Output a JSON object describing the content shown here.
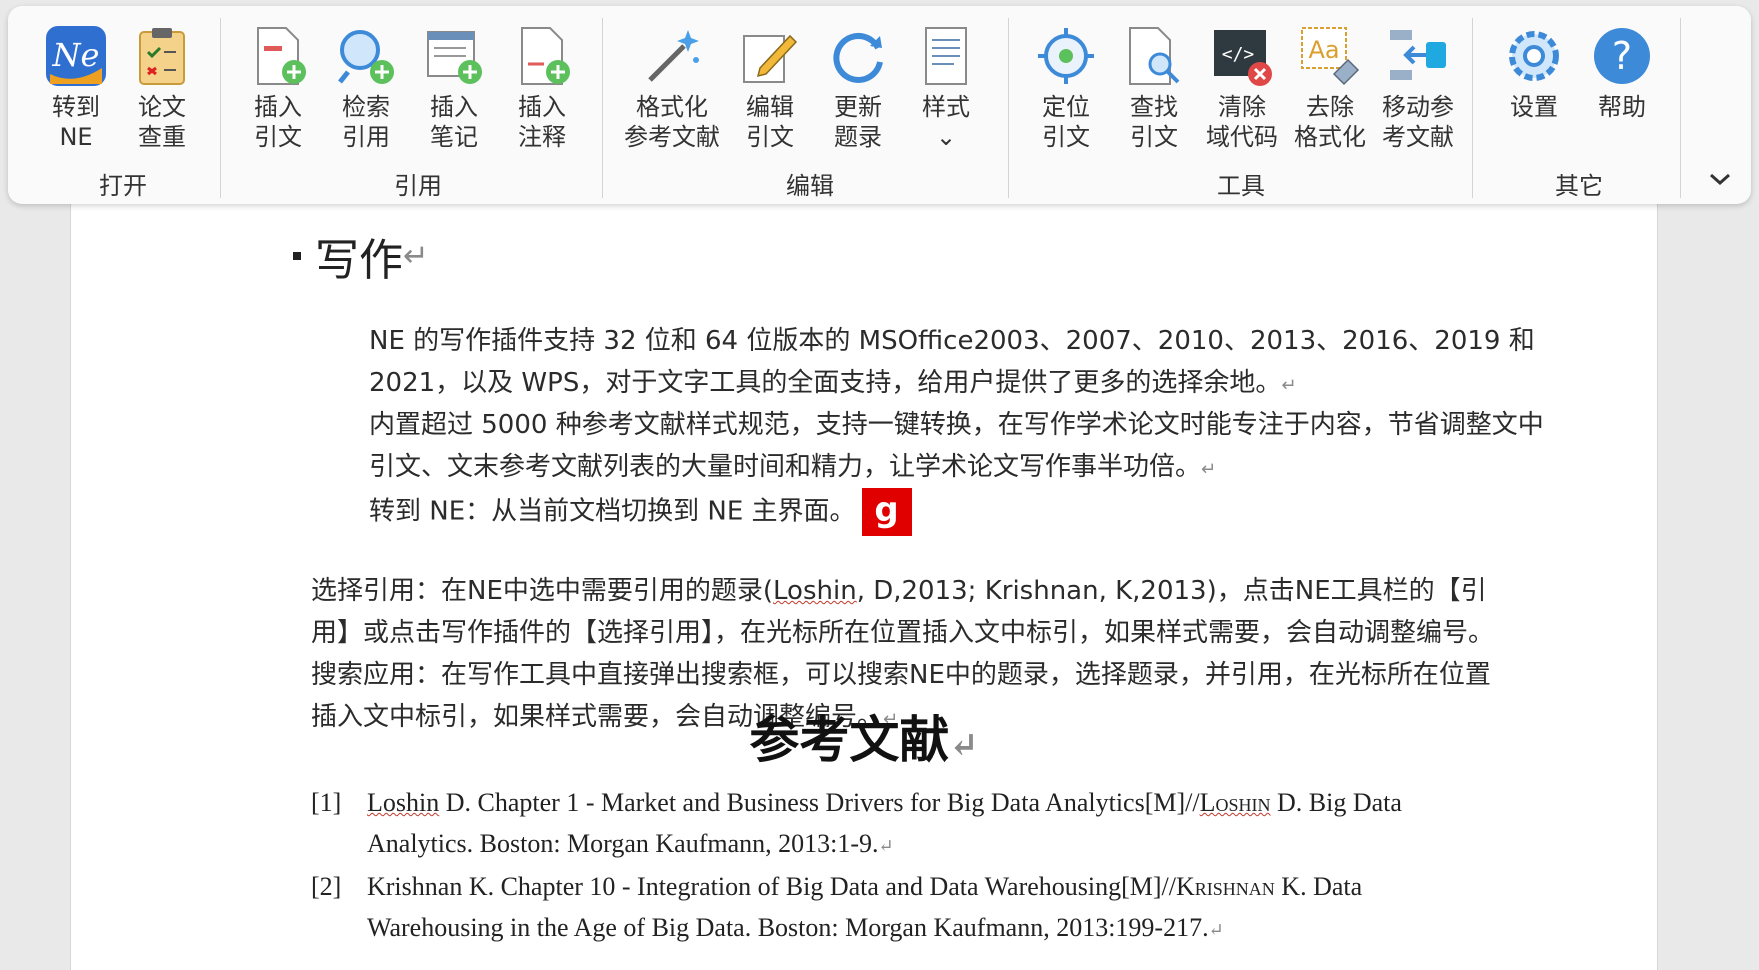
{
  "ribbon": {
    "groups": {
      "open": "打开",
      "cite": "引用",
      "edit": "编辑",
      "tools": "工具",
      "other": "其它"
    },
    "buttons": {
      "goto_ne": "转到\nNE",
      "plagiarism": "论文\n查重",
      "insert_cite": "插入\n引文",
      "search_cite": "检索\n引用",
      "insert_note": "插入\n笔记",
      "insert_annot": "插入\n注释",
      "format_refs": "格式化\n参考文献",
      "edit_cite": "编辑\n引文",
      "update_list": "更新\n题录",
      "style": "样式\n⌄",
      "locate_cite": "定位\n引文",
      "find_cite": "查找\n引文",
      "clear_fields": "清除\n域代码",
      "remove_format": "去除\n格式化",
      "move_refs": "移动参\n考文献",
      "settings": "设置",
      "help": "帮助"
    },
    "ne_logo": "Ne",
    "collapse_icon": "chevron-down-icon"
  },
  "document": {
    "heading": "写作",
    "para1": "NE 的写作插件支持 32 位和 64 位版本的 MSOffice2003、2007、2010、2013、2016、2019 和 2021，以及 WPS，对于文字工具的全面支持，给用户提供了更多的选择余地。",
    "para2": "内置超过 5000 种参考文献样式规范，支持一键转换，在写作学术论文时能专注于内容，节省调整文中引文、文末参考文献列表的大量时间和精力，让学术论文写作事半功倍。",
    "para3": "转到 NE：从当前文档切换到 NE 主界面。",
    "cursor_box": "g",
    "para4_pre": "选择引用：在NE中选中需要引用的题录(",
    "para4_wavy": "Loshin",
    "para4_post": ", D,2013; Krishnan, K,2013)，点击NE工具栏的【引用】或点击写作插件的【选择引用】，在光标所在位置插入文中标引，如果样式需要，会自动调整编号。搜索应用：在写作工具中直接弹出搜索框，可以搜索NE中的题录，选择题录，并引用，在光标所在位置插入文中标引，如果样式需要，会自动调整编号。",
    "refs_title": "参考文献",
    "refs": [
      {
        "num": "[1]",
        "a": "Loshin",
        "b": " D. Chapter 1 - Market and Business Drivers for Big Data Analytics[M]//",
        "c": "Loshin",
        "d": " D. Big Data Analytics. Boston: Morgan Kaufmann, 2013:1-9."
      },
      {
        "num": "[2]",
        "a": "",
        "b": "Krishnan K. Chapter 10 - Integration of Big Data and Data Warehousing[M]//",
        "c": "Krishnan",
        "d": " K. Data Warehousing in the Age of Big Data. Boston: Morgan Kaufmann, 2013:199-217."
      }
    ],
    "para_mark": "↵"
  }
}
